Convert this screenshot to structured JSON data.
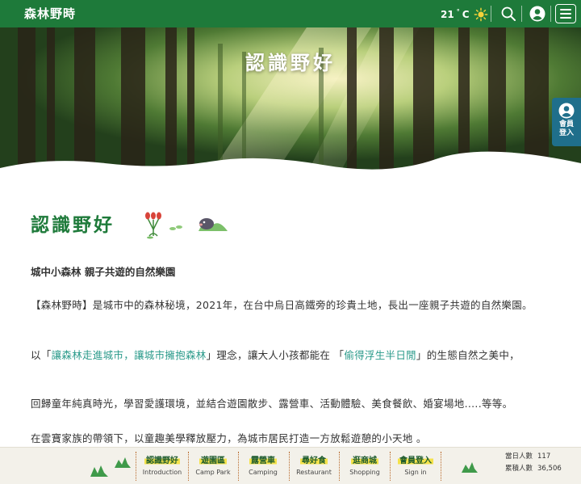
{
  "header": {
    "logo_text": "森林野時",
    "temperature": "21",
    "temp_unit": "C",
    "icons": [
      "sun-icon",
      "search-icon",
      "user-icon",
      "menu-icon"
    ]
  },
  "hero": {
    "title": "認識野好"
  },
  "member_tab": {
    "label": "會員登入"
  },
  "content": {
    "title": "認識野好",
    "subtitle": "城中小森林 親子共遊的自然樂園",
    "p1": "【森林野時】是城市中的森林秘境，2021年，在台中烏日高鐵旁的珍貴土地，長出一座親子共遊的自然樂園。",
    "p2_a": "以「",
    "p2_hl1": "讓森林走進城市，讓城市擁抱森林",
    "p2_b": "」理念，讓大人小孩都能在 「",
    "p2_hl2": "偷得浮生半日閒",
    "p2_c": "」的生態自然之美中，",
    "p3": "回歸童年純真時光，學習愛護環境，並結合遊園散步、露營車、活動體驗、美食餐飲、婚宴場地.....等等。",
    "p4": "在雲寶家族的帶領下，以童趣美學釋放壓力，為城市居民打造一方放鬆遊憩的小天地 。"
  },
  "bottom_nav": {
    "items": [
      {
        "zh": "認識野好",
        "en": "Introduction"
      },
      {
        "zh": "遊園區",
        "en": "Camp Park"
      },
      {
        "zh": "露營車",
        "en": "Camping"
      },
      {
        "zh": "尋好食",
        "en": "Restaurant"
      },
      {
        "zh": "逛商城",
        "en": "Shopping"
      },
      {
        "zh": "會員登入",
        "en": "Sign in"
      }
    ],
    "stats": {
      "today_label": "當日人數",
      "today_value": "117",
      "total_label": "累積人數",
      "total_value": "36,506"
    }
  },
  "colors": {
    "brand_green": "#1e7a3a",
    "teal_highlight": "#2a9a8a",
    "member_tab": "#1f6f8b",
    "nav_highlight": "#f4e24a"
  }
}
